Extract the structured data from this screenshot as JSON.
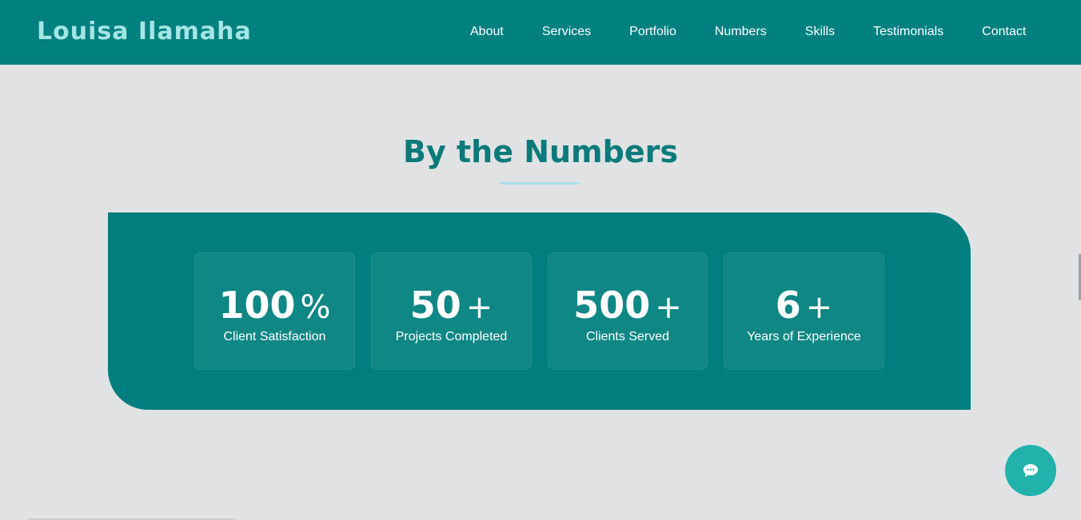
{
  "header": {
    "brand": "Louisa Ilamaha",
    "nav": [
      {
        "label": "About"
      },
      {
        "label": "Services"
      },
      {
        "label": "Portfolio"
      },
      {
        "label": "Numbers"
      },
      {
        "label": "Skills"
      },
      {
        "label": "Testimonials"
      },
      {
        "label": "Contact"
      }
    ]
  },
  "numbers_section": {
    "title": "By the Numbers",
    "stats": [
      {
        "value": "100",
        "suffix": "%",
        "label": "Client Satisfaction"
      },
      {
        "value": "50",
        "suffix": "+",
        "label": "Projects Completed"
      },
      {
        "value": "500",
        "suffix": "+",
        "label": "Clients Served"
      },
      {
        "value": "6",
        "suffix": "+",
        "label": "Years of Experience"
      }
    ]
  },
  "chat": {
    "icon": "chat-bubble-icon"
  },
  "colors": {
    "primary": "#018080",
    "brand_text": "#a3e6e4",
    "title_text": "#0a7b7a",
    "card_bg": "#0f8785",
    "chat_button": "#21b2ab",
    "page_bg": "#e1e2e4"
  }
}
